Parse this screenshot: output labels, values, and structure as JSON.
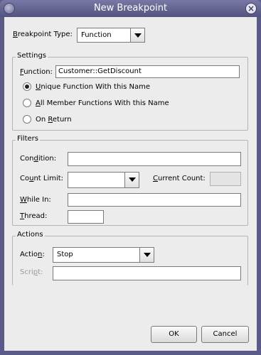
{
  "window": {
    "title": "New Breakpoint",
    "close_symbol": "×"
  },
  "breakpoint_type": {
    "label_mnemonic": "B",
    "label_rest": "reakpoint Type:",
    "value": "Function"
  },
  "settings": {
    "title": "Settings",
    "function_label_mnemonic": "F",
    "function_label_rest": "unction:",
    "function_value": "Customer::GetDiscount",
    "radios": [
      {
        "pre": "",
        "mnemonic": "U",
        "post": "nique Function With this Name",
        "checked": true
      },
      {
        "pre": "",
        "mnemonic": "A",
        "post": "ll Member Functions With this Name",
        "checked": false
      },
      {
        "pre": "On ",
        "mnemonic": "R",
        "post": "eturn",
        "checked": false
      }
    ]
  },
  "filters": {
    "title": "Filters",
    "condition_pre": "Con",
    "condition_mnemonic": "d",
    "condition_post": "ition:",
    "count_limit_pre": "Co",
    "count_limit_mnemonic": "u",
    "count_limit_post": "nt Limit:",
    "current_count_mnemonic": "C",
    "current_count_rest": "urrent Count:",
    "while_in_mnemonic": "W",
    "while_in_rest": "hile In:",
    "thread_mnemonic": "T",
    "thread_rest": "hread:",
    "condition_value": "",
    "count_limit_value": "",
    "current_count_value": "",
    "while_in_value": "",
    "thread_value": ""
  },
  "actions": {
    "title": "Actions",
    "action_label_pre": "Actio",
    "action_label_mnemonic": "n",
    "action_label_post": ":",
    "action_value": "Stop",
    "script_label_pre": "Scri",
    "script_label_mnemonic": "p",
    "script_label_post": "t:",
    "script_value": ""
  },
  "buttons": {
    "ok": "OK",
    "cancel": "Cancel"
  },
  "colors": {
    "title_bar": "#5b5b8a",
    "dialog_bg": "#ececec"
  },
  "icons": {
    "window": "app-icon",
    "close": "close-icon",
    "dropdown": "chevron-down-icon"
  }
}
